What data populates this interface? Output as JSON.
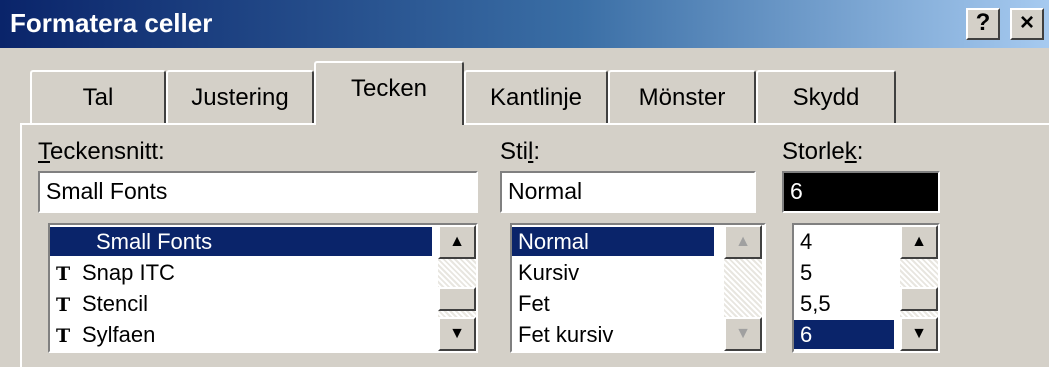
{
  "window": {
    "title": "Formatera celler",
    "help_label": "?",
    "close_label": "×"
  },
  "tabs": [
    {
      "label": "Tal",
      "active": false
    },
    {
      "label": "Justering",
      "active": false
    },
    {
      "label": "Tecken",
      "active": true
    },
    {
      "label": "Kantlinje",
      "active": false
    },
    {
      "label": "Mönster",
      "active": false
    },
    {
      "label": "Skydd",
      "active": false
    }
  ],
  "font": {
    "label_mnemonic": "T",
    "label_rest": "eckensnitt:",
    "value": "Small Fonts",
    "items": [
      {
        "label": "Small Fonts",
        "truetype": false,
        "selected": true
      },
      {
        "label": "Snap ITC",
        "truetype": true,
        "selected": false
      },
      {
        "label": "Stencil",
        "truetype": true,
        "selected": false
      },
      {
        "label": "Sylfaen",
        "truetype": true,
        "selected": false
      }
    ]
  },
  "style": {
    "label_pre": "Sti",
    "label_mnemonic": "l",
    "label_post": ":",
    "value": "Normal",
    "items": [
      {
        "label": "Normal",
        "selected": true
      },
      {
        "label": "Kursiv",
        "selected": false
      },
      {
        "label": "Fet",
        "selected": false
      },
      {
        "label": "Fet kursiv",
        "selected": false
      }
    ]
  },
  "size": {
    "label_pre": "Storle",
    "label_mnemonic": "k",
    "label_post": ":",
    "value": "6",
    "items": [
      {
        "label": "4",
        "selected": false
      },
      {
        "label": "5",
        "selected": false
      },
      {
        "label": "5,5",
        "selected": false
      },
      {
        "label": "6",
        "selected": true
      }
    ]
  },
  "icons": {
    "truetype": "truetype-font-icon",
    "scroll_up": "arrow-up-icon",
    "scroll_down": "arrow-down-icon"
  },
  "colors": {
    "dialog_bg": "#d4d0c8",
    "title_start": "#0a246a",
    "title_end": "#a6caf0",
    "selection": "#0a246a"
  }
}
